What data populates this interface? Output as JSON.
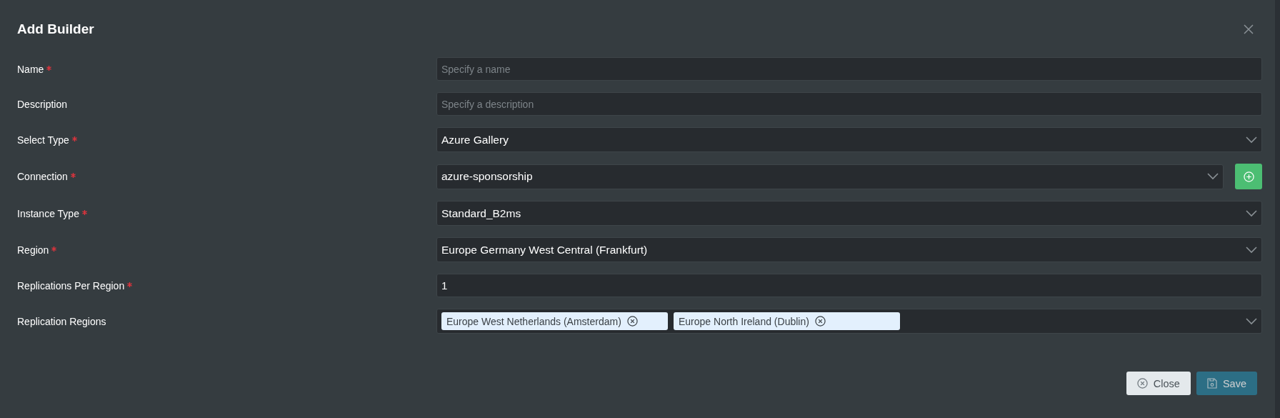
{
  "dialog": {
    "title": "Add Builder"
  },
  "fields": [
    {
      "label": "Name",
      "required": true,
      "kind": "text",
      "placeholder": "Specify a name"
    },
    {
      "label": "Description",
      "required": false,
      "kind": "text",
      "placeholder": "Specify a description"
    },
    {
      "label": "Select Type",
      "required": true,
      "kind": "select",
      "value": "Azure Gallery"
    },
    {
      "label": "Connection",
      "required": true,
      "kind": "select-add",
      "value": "azure-sponsorship"
    },
    {
      "label": "Instance Type",
      "required": true,
      "kind": "select",
      "value": "Standard_B2ms"
    },
    {
      "label": "Region",
      "required": true,
      "kind": "select",
      "value": "Europe Germany West Central (Frankfurt)"
    },
    {
      "label": "Replications Per Region",
      "required": true,
      "kind": "text",
      "value": "1"
    },
    {
      "label": "Replication Regions",
      "required": false,
      "kind": "multi",
      "tags": [
        "Europe West Netherlands (Amsterdam)",
        "Europe North Ireland (Dublin)"
      ]
    }
  ],
  "buttons": [
    {
      "label": "Close",
      "kind": "close",
      "disabled": false
    },
    {
      "label": "Save",
      "kind": "save",
      "disabled": true
    }
  ]
}
